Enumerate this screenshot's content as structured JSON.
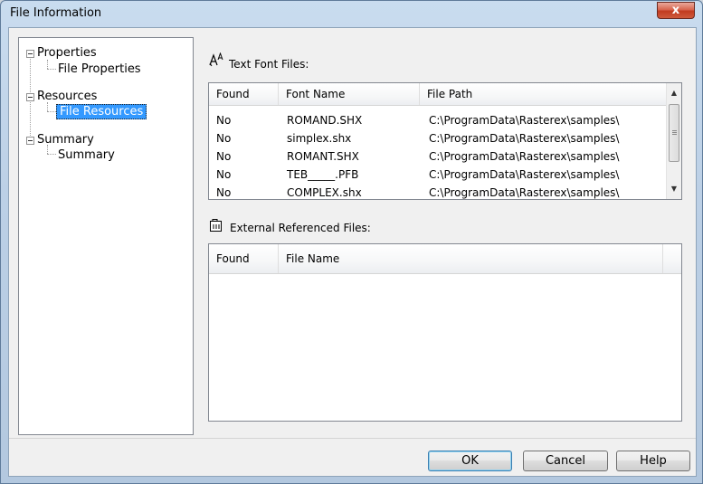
{
  "window": {
    "title": "File Information",
    "close_glyph": "x"
  },
  "tree": {
    "items": [
      {
        "label": "Properties",
        "level": 0
      },
      {
        "label": "File Properties",
        "level": 1
      },
      {
        "label": "Resources",
        "level": 0
      },
      {
        "label": "File Resources",
        "level": 1,
        "selected": true
      },
      {
        "label": "Summary",
        "level": 0
      },
      {
        "label": "Summary",
        "level": 1
      }
    ]
  },
  "fonts_section": {
    "label": "Text Font Files:",
    "icon": "font-icon",
    "columns": [
      "Found",
      "Font Name",
      "File Path"
    ],
    "rows": [
      [
        "No",
        "ROMAND.SHX",
        "C:\\ProgramData\\Rasterex\\samples\\"
      ],
      [
        "No",
        "simplex.shx",
        "C:\\ProgramData\\Rasterex\\samples\\"
      ],
      [
        "No",
        "ROMANT.SHX",
        "C:\\ProgramData\\Rasterex\\samples\\"
      ],
      [
        "No",
        "TEB_____.PFB",
        "C:\\ProgramData\\Rasterex\\samples\\"
      ],
      [
        "No",
        "COMPLEX.shx",
        "C:\\ProgramData\\Rasterex\\samples\\"
      ]
    ]
  },
  "refs_section": {
    "label": "External Referenced Files:",
    "icon": "external-reference-icon",
    "columns": [
      "Found",
      "File Name"
    ]
  },
  "buttons": {
    "ok": "OK",
    "cancel": "Cancel",
    "help": "Help"
  },
  "colors": {
    "selection": "#3399ff",
    "titlebar": "#c9dcef",
    "close": "#c13b20"
  }
}
